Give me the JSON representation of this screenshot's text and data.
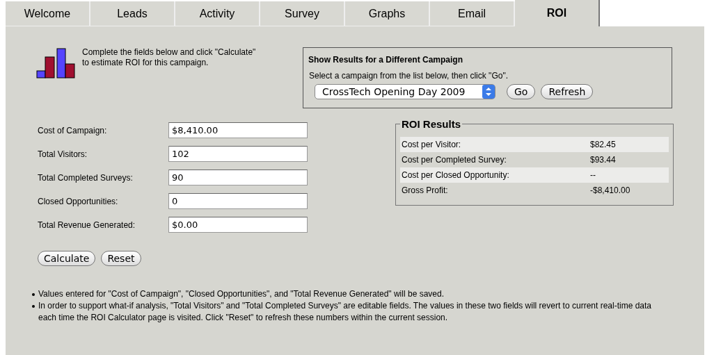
{
  "tabs": [
    {
      "label": "Welcome",
      "selected": false
    },
    {
      "label": "Leads",
      "selected": false
    },
    {
      "label": "Activity",
      "selected": false
    },
    {
      "label": "Survey",
      "selected": false
    },
    {
      "label": "Graphs",
      "selected": false
    },
    {
      "label": "Email",
      "selected": false
    },
    {
      "label": "ROI",
      "selected": true
    }
  ],
  "intro": "Complete the fields below and click \"Calculate\" to estimate ROI for this campaign.",
  "campaign_box": {
    "title": "Show Results for a Different Campaign",
    "hint": "Select a campaign from the list below, then click \"Go\".",
    "campaign": "CrossTech Opening Day 2009",
    "buttons": [
      "Go",
      "Refresh"
    ]
  },
  "fields": [
    {
      "label": "Cost of Campaign:",
      "value": "$8,410.00"
    },
    {
      "label": "Total Visitors:",
      "value": "102"
    },
    {
      "label": "Total Completed Surveys:",
      "value": "90"
    },
    {
      "label": "Closed Opportunities:",
      "value": "0"
    },
    {
      "label": "Total Revenue Generated:",
      "value": "$0.00"
    }
  ],
  "buttons": [
    "Calculate",
    "Reset"
  ],
  "results": {
    "title": "ROI Results",
    "rows": [
      {
        "label": "Cost per Visitor:",
        "value": "$82.45"
      },
      {
        "label": "Cost per Completed Survey:",
        "value": "$93.44"
      },
      {
        "label": "Cost per Closed Opportunity:",
        "value": "--"
      },
      {
        "label": "Gross Profit:",
        "value": "-$8,410.00"
      }
    ]
  },
  "notes": [
    "Values entered for \"Cost of Campaign\", \"Closed Opportunities\", and \"Total Revenue Generated\" will be saved.",
    "In order to support what-if analysis, \"Total Visitors\" and \"Total Completed Surveys\" are editable fields. The values in these two fields will revert to current real-time data each time the ROI Calculator page is visited. Click \"Reset\" to refresh these numbers within the current session."
  ]
}
